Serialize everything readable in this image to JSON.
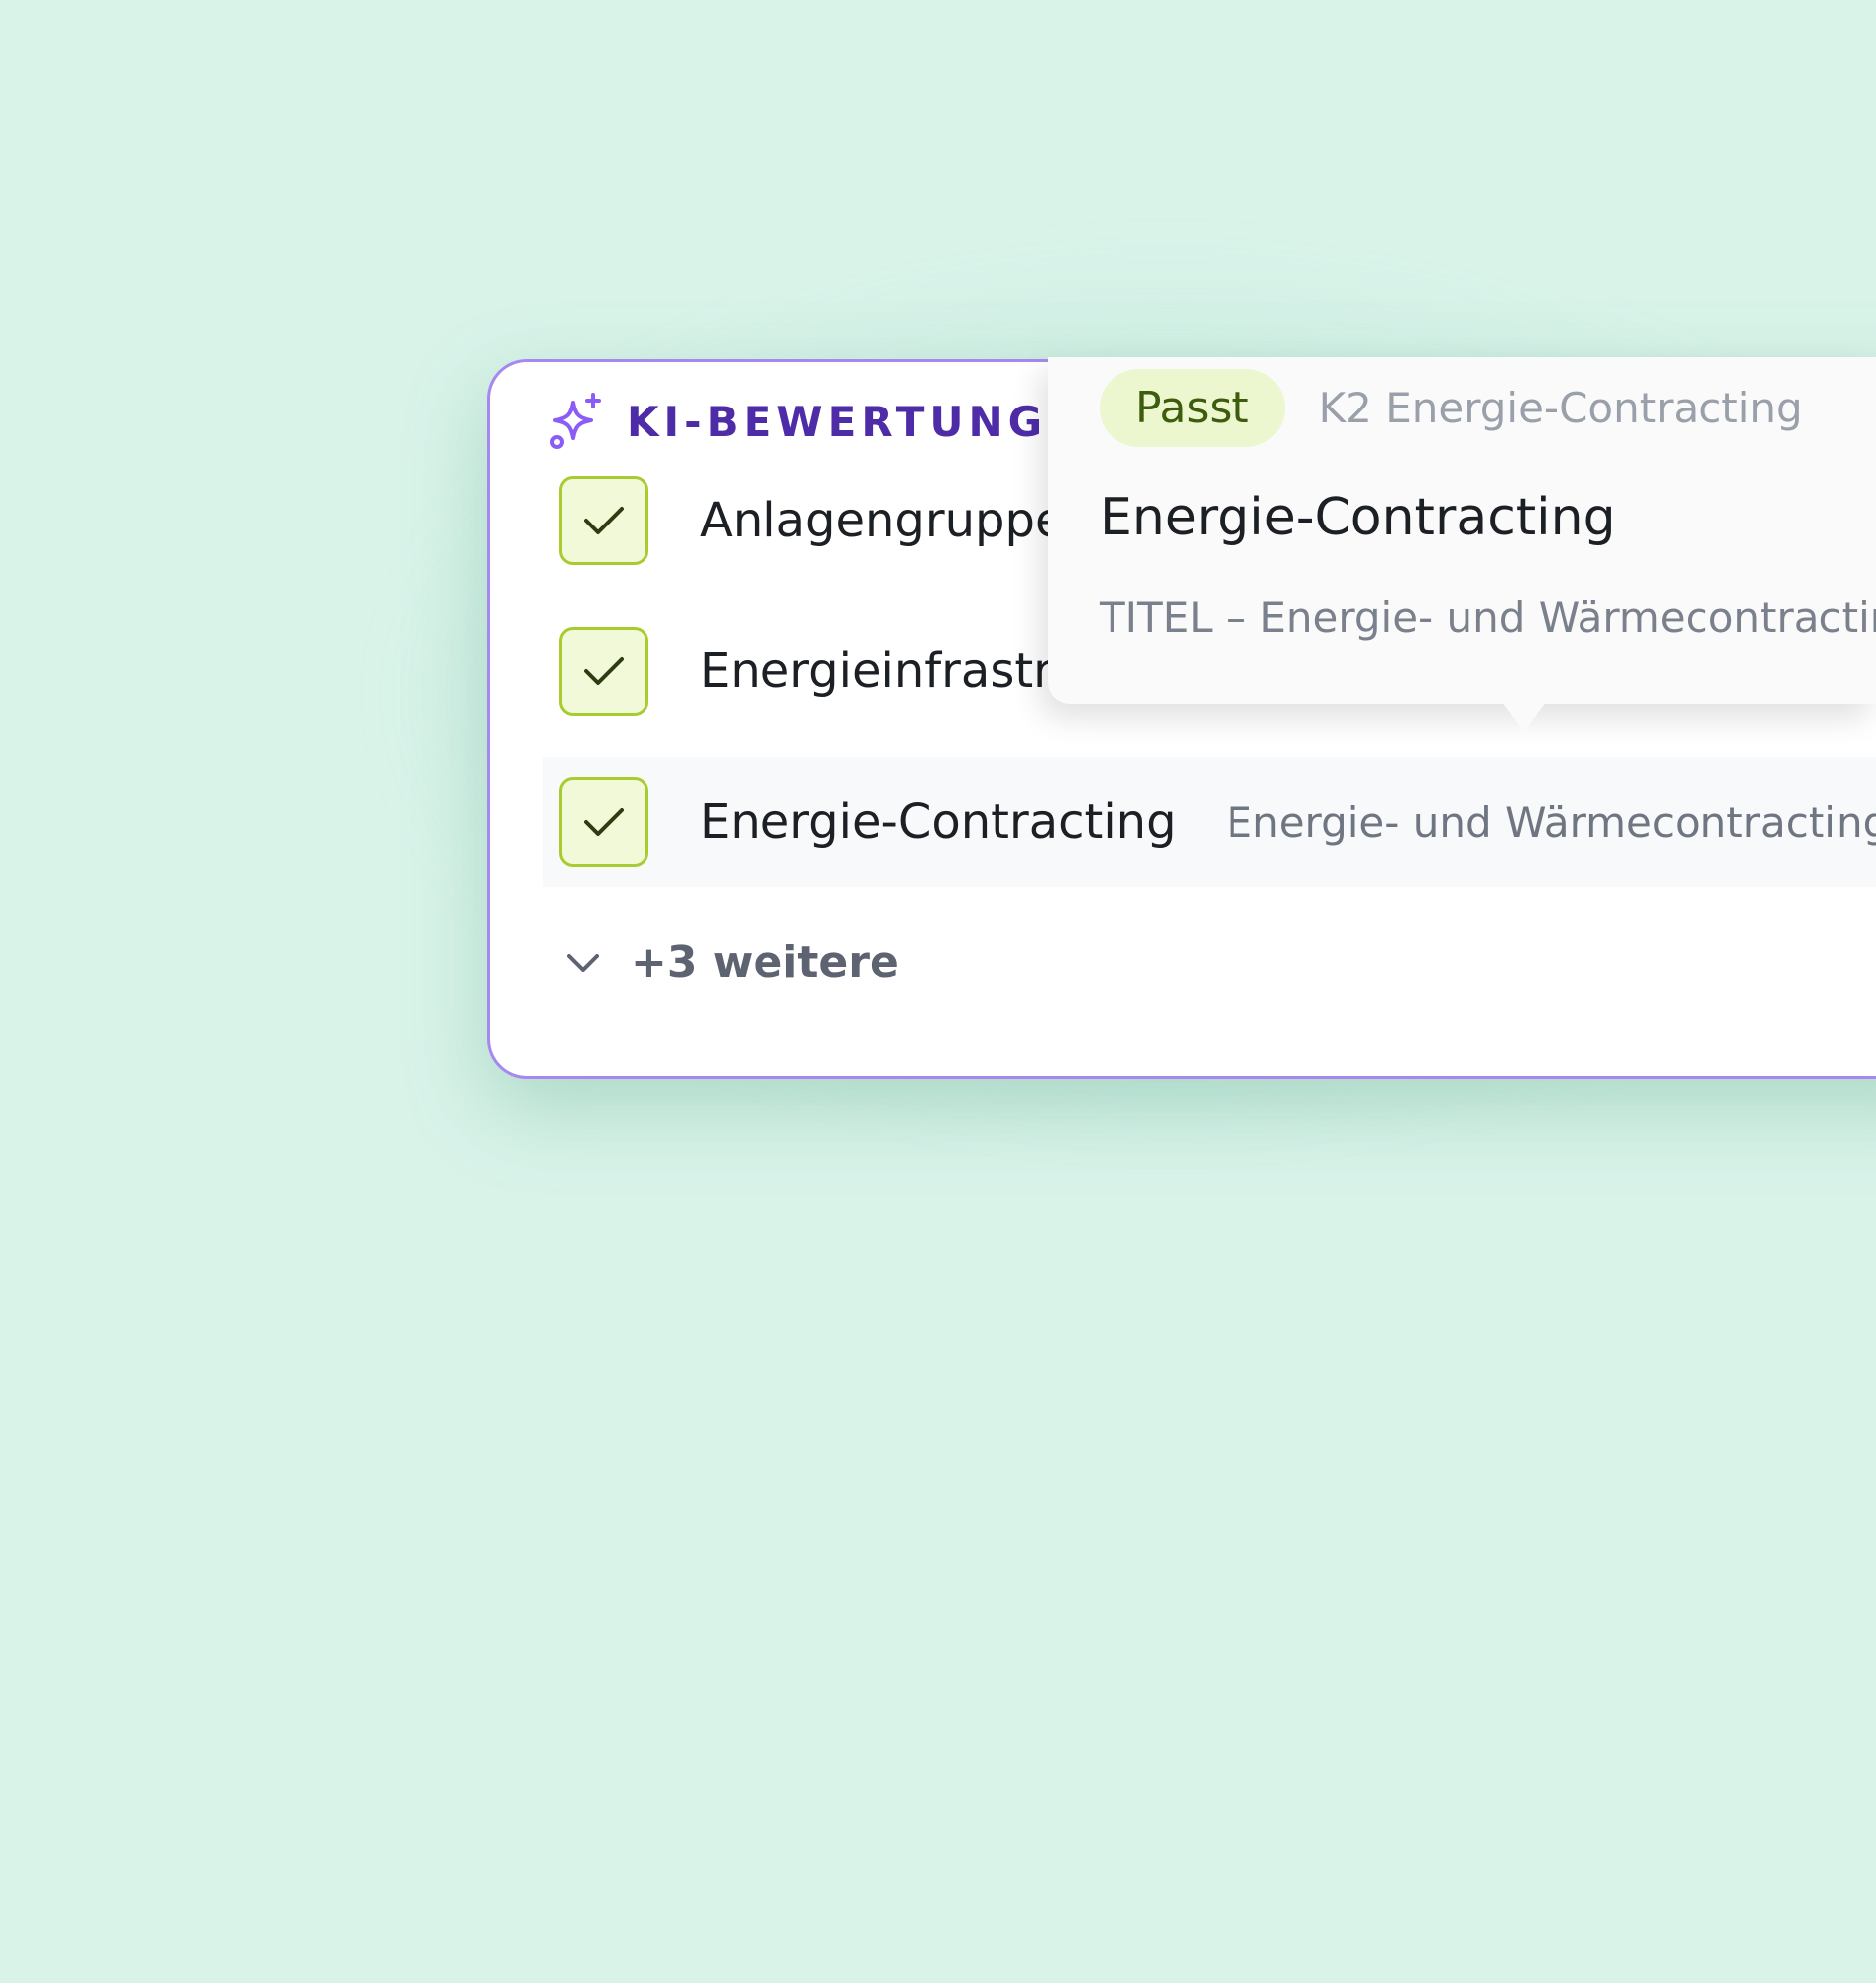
{
  "panel": {
    "title": "KI-BEWERTUNG",
    "title_icon": "sparkle-icon"
  },
  "rows": [
    {
      "label": "Anlagengruppe",
      "checked": true
    },
    {
      "label": "Energieinfrastruktur",
      "checked": true
    },
    {
      "label": "Energie-Contracting",
      "sub": "Energie- und Wärmecontracting",
      "checked": true
    }
  ],
  "more": {
    "label": "+3 weitere",
    "icon": "chevron-down-icon"
  },
  "tooltip": {
    "badge": "Passt",
    "ref": "K2 Energie-Contracting",
    "title": "Energie-Contracting",
    "description": "TITEL – Energie- und Wärmecontracting"
  },
  "colors": {
    "background": "#d9f3e9",
    "accent": "#4e2ca8",
    "border": "#a888ee",
    "check": "#a8cc30",
    "badge_bg": "#ecf6cf",
    "badge_text": "#3d5c0e"
  }
}
